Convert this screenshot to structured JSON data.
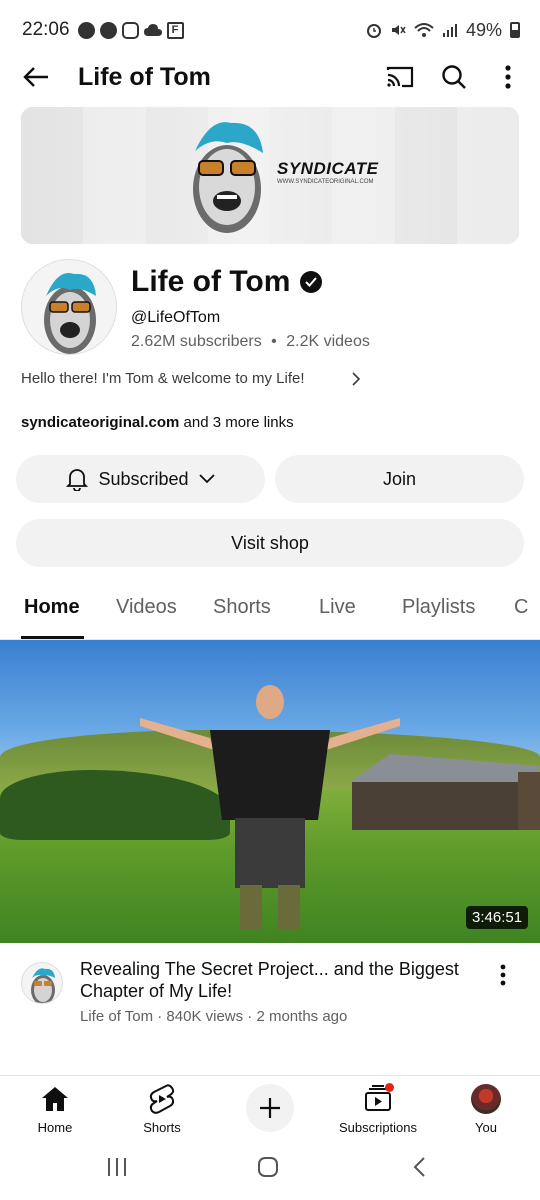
{
  "status_bar": {
    "time": "22:06",
    "battery": "49%"
  },
  "top_bar": {
    "title": "Life of Tom"
  },
  "banner": {
    "brand": "SYNDICATE",
    "site": "WWW.SYNDICATEORIGINAL.COM"
  },
  "channel": {
    "name": "Life of Tom",
    "handle": "@LifeOfTom",
    "subscribers": "2.62M subscribers",
    "separator": "•",
    "videos": "2.2K videos",
    "description": "Hello there! I'm Tom & welcome to my Life!",
    "links_main": "syndicateoriginal.com",
    "links_more": " and 3 more links"
  },
  "buttons": {
    "subscribed": "Subscribed",
    "join": "Join",
    "visit_shop": "Visit shop"
  },
  "tabs": [
    {
      "label": "Home",
      "active": true
    },
    {
      "label": "Videos",
      "active": false
    },
    {
      "label": "Shorts",
      "active": false
    },
    {
      "label": "Live",
      "active": false
    },
    {
      "label": "Playlists",
      "active": false
    },
    {
      "label": "C",
      "active": false
    }
  ],
  "video": {
    "duration": "3:46:51",
    "title": "Revealing The Secret Project... and the Biggest Chapter of My Life!",
    "meta": "Life of Tom · 840K views · 2 months ago"
  },
  "bottom_nav": [
    {
      "label": "Home",
      "icon": "home-icon"
    },
    {
      "label": "Shorts",
      "icon": "shorts-icon"
    },
    {
      "label": "",
      "icon": "plus-icon"
    },
    {
      "label": "Subscriptions",
      "icon": "subscriptions-icon"
    },
    {
      "label": "You",
      "icon": "avatar"
    }
  ],
  "colors": {
    "text": "#0f0f0f",
    "secondary_text": "#606060",
    "chip_bg": "#f2f2f2",
    "accent_red": "#e62117"
  }
}
